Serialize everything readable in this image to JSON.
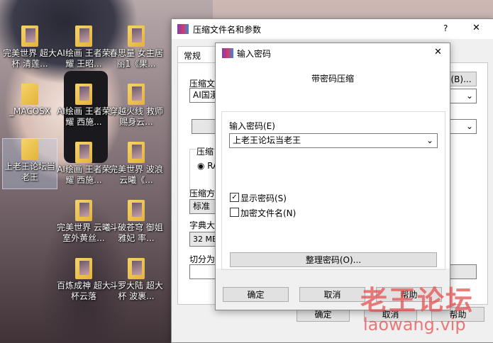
{
  "desktop": {
    "icons": [
      {
        "label": "完美世界 超大杯 清莲..."
      },
      {
        "label": "AI绘画 王者荣耀 王昭..."
      },
      {
        "label": "春思量 女主居丽1《果..."
      },
      {
        "label": "_MACOSX"
      },
      {
        "label": "AI绘画 王者荣耀 西施..."
      },
      {
        "label": "穿越火线 救师赐身云..."
      },
      {
        "label": "上老王论坛当老王"
      },
      {
        "label": "AI绘画 王者荣耀 西施..."
      },
      {
        "label": "完美世界 波浪 云曦《..."
      },
      {
        "label": "完美世界 云曦 室外黄丝..."
      },
      {
        "label": "斗破苍穹 御姐 雅妃 率..."
      },
      {
        "label": "百炼成神 超大杯云落"
      },
      {
        "label": "斗罗大陆 超大杯 波裹..."
      }
    ]
  },
  "back_dialog": {
    "title": "压缩文件名和参数",
    "help_glyph": "?",
    "close_glyph": "✕",
    "tab_general": "常规",
    "archive_label": "压缩文",
    "archive_value": "AI国漫",
    "browse_label": "(B)...",
    "format_label": "压缩",
    "format_option": "RA",
    "method_label": "压缩方",
    "method_value": "标准",
    "dict_label": "字典大",
    "dict_value": "32 MB",
    "split_label": "切分为",
    "ok": "确定",
    "cancel": "取消",
    "help": "帮助"
  },
  "password_dialog": {
    "title": "输入密码",
    "close_glyph": "✕",
    "heading": "带密码压缩",
    "enter_label": "输入密码(E)",
    "password_value": "上老王论坛当老王",
    "show_password": "显示密码(S)",
    "show_password_checked": true,
    "encrypt_names": "加密文件名(N)",
    "encrypt_names_checked": false,
    "organize": "整理密码(O)...",
    "ok": "确定",
    "cancel": "取消",
    "help": "帮助"
  },
  "watermark": {
    "text": "老王论坛",
    "url": "laowang.vip"
  }
}
